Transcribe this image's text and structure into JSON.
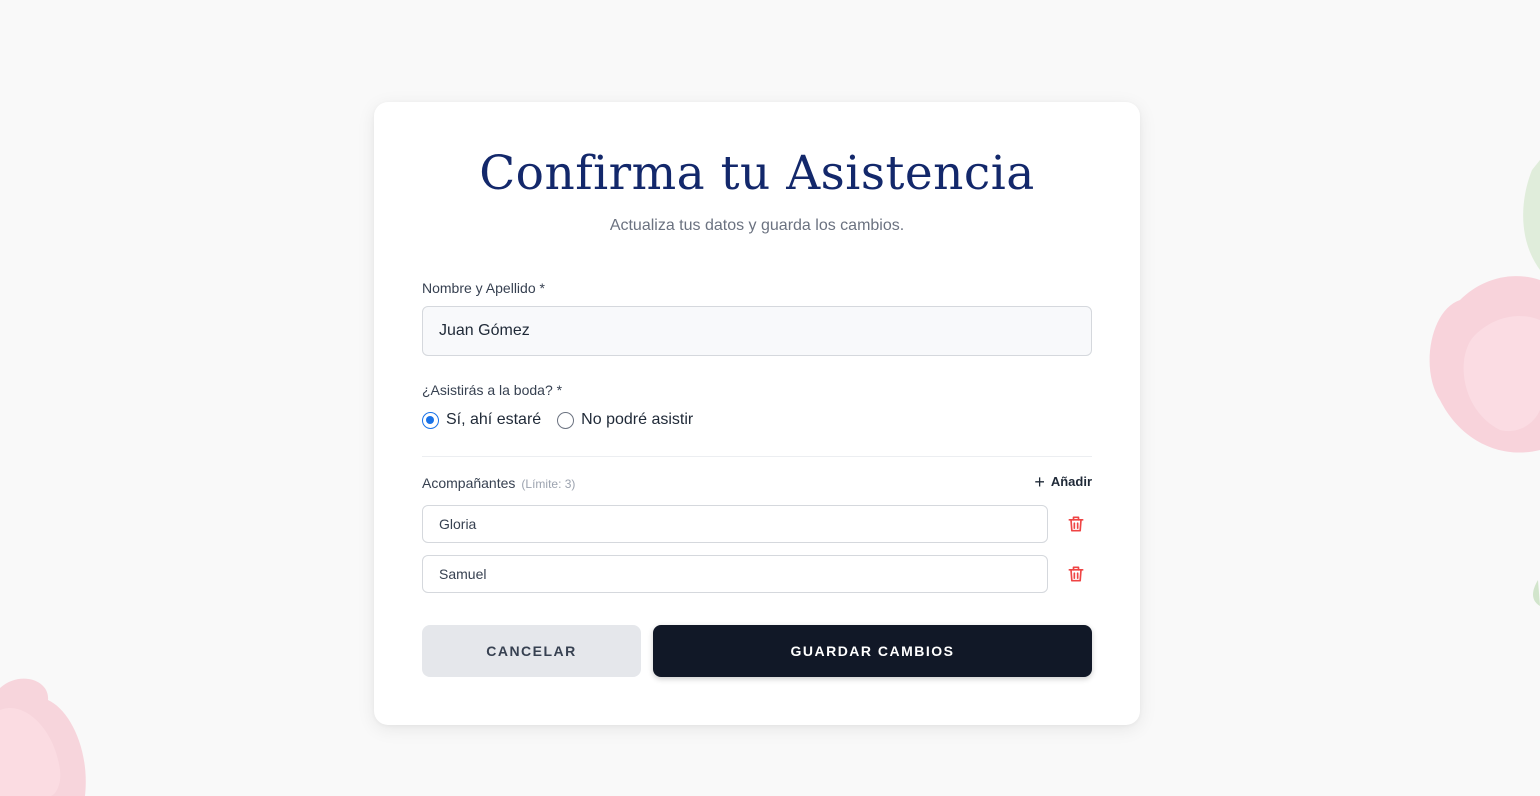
{
  "form": {
    "title": "Confirma tu Asistencia",
    "subtitle": "Actualiza tus datos y guarda los cambios.",
    "name_label": "Nombre y Apellido *",
    "name_value": "Juan Gómez",
    "attend_label": "¿Asistirás a la boda? *",
    "attend_options": [
      {
        "label": "Sí, ahí estaré",
        "checked": true
      },
      {
        "label": "No podré asistir",
        "checked": false
      }
    ],
    "companions_label": "Acompañantes",
    "companions_limit": "(Límite: 3)",
    "add_label": "Añadir",
    "companions": [
      {
        "value": "Gloria"
      },
      {
        "value": "Samuel"
      }
    ],
    "cancel_label": "CANCELAR",
    "save_label": "GUARDAR CAMBIOS"
  },
  "colors": {
    "title": "#13286b",
    "accent": "#1a73e8",
    "primary_button": "#111827",
    "delete_icon": "#ef4444",
    "background": "#f9f9f9"
  },
  "icons": {
    "add": "plus-icon",
    "delete": "trash-icon"
  }
}
